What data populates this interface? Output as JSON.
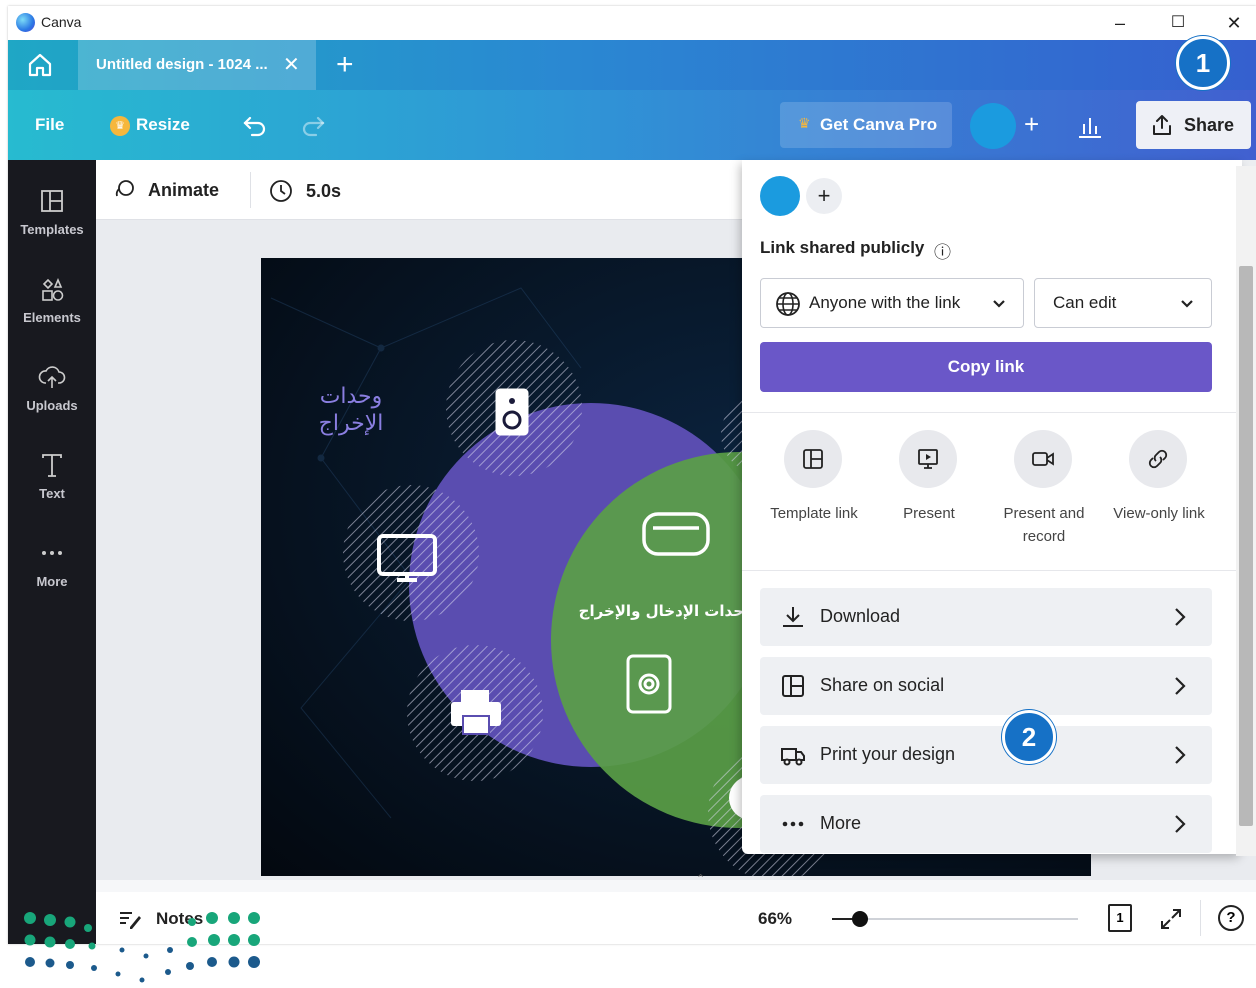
{
  "window": {
    "app_name": "Canva",
    "minimize": "–",
    "maximize": "☐",
    "close": "✕"
  },
  "tab": {
    "title": "Untitled design - 1024 ...",
    "close": "✕",
    "new_tab": "+"
  },
  "toolbar": {
    "file": "File",
    "resize": "Resize",
    "get_pro": "Get Canva Pro",
    "add_member": "+",
    "share": "Share"
  },
  "sidebar": {
    "items": [
      {
        "label": "Templates",
        "icon": "templates-icon"
      },
      {
        "label": "Elements",
        "icon": "elements-icon"
      },
      {
        "label": "Uploads",
        "icon": "uploads-icon"
      },
      {
        "label": "Text",
        "icon": "text-icon"
      },
      {
        "label": "More",
        "icon": "more-icon"
      }
    ]
  },
  "editor_bar": {
    "animate": "Animate",
    "duration": "5.0s"
  },
  "design": {
    "title_ar": "وحدات",
    "title_ar_2": "الإخراج",
    "center_ar": "وحدات الإدخال والإخراج",
    "colors": {
      "purple": "#5a4db0",
      "green": "#5a9e46",
      "bg": "#071525"
    }
  },
  "share_panel": {
    "add": "+",
    "heading": "Link shared publicly",
    "info_icon": "ⓘ",
    "access": "Anyone with the link",
    "permission": "Can edit",
    "copy_link": "Copy link",
    "options": [
      {
        "label": "Template link",
        "icon": "template-icon"
      },
      {
        "label": "Present",
        "icon": "present-icon"
      },
      {
        "label": "Present and record",
        "icon": "record-icon"
      },
      {
        "label": "View-only link",
        "icon": "link-icon"
      }
    ],
    "actions": [
      {
        "label": "Download",
        "icon": "download-icon"
      },
      {
        "label": "Share on social",
        "icon": "social-icon"
      },
      {
        "label": "Print your design",
        "icon": "print-icon"
      },
      {
        "label": "More",
        "icon": "more-dots-icon"
      }
    ]
  },
  "bottom": {
    "notes": "Notes",
    "zoom": "66%",
    "zoom_level": 0.12,
    "page": "1",
    "help": "?"
  },
  "callouts": {
    "one": "1",
    "two": "2"
  },
  "colors": {
    "accent": "#6a57c8",
    "callout": "#1671c6",
    "sidebar": "#18191f"
  }
}
